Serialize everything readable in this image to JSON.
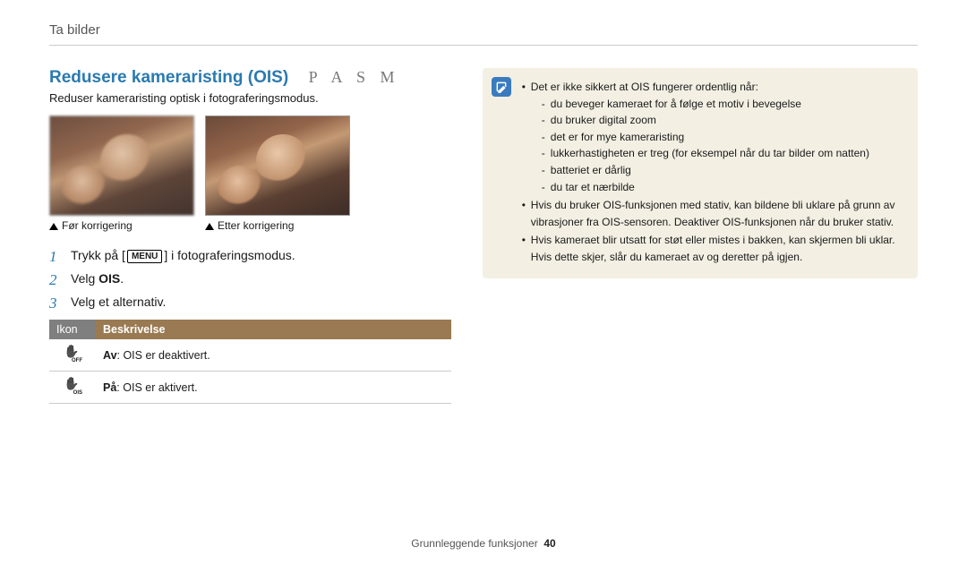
{
  "breadcrumb": "Ta bilder",
  "section": {
    "title": "Redusere kameraristing (OIS)",
    "modes": "P A S M",
    "subheading": "Reduser kameraristing optisk i fotograferingsmodus."
  },
  "captions": {
    "before": "Før korrigering",
    "after": "Etter korrigering"
  },
  "steps": {
    "s1_pre": "Trykk på [",
    "s1_menu": "MENU",
    "s1_post": "] i fotograferingsmodus.",
    "s2_pre": "Velg ",
    "s2_bold": "OIS",
    "s2_post": ".",
    "s3": "Velg et alternativ."
  },
  "table": {
    "head_ikon": "Ikon",
    "head_desc": "Beskrivelse",
    "rows": [
      {
        "sub": "OFF",
        "bold": "Av",
        "rest": ": OIS er deaktivert."
      },
      {
        "sub": "OIS",
        "bold": "På",
        "rest": ": OIS er aktivert."
      }
    ]
  },
  "note": {
    "items": [
      {
        "text": "Det er ikke sikkert at OIS fungerer ordentlig når:",
        "sub": [
          "du beveger kameraet for å følge et motiv i bevegelse",
          "du bruker digital zoom",
          "det er for mye kameraristing",
          "lukkerhastigheten er treg (for eksempel når du tar bilder om natten)",
          "batteriet er dårlig",
          "du tar et nærbilde"
        ]
      },
      {
        "text": "Hvis du bruker OIS-funksjonen med stativ, kan bildene bli uklare på grunn av vibrasjoner fra OIS-sensoren. Deaktiver OIS-funksjonen når du bruker stativ."
      },
      {
        "text": "Hvis kameraet blir utsatt for støt eller mistes i bakken, kan skjermen bli uklar. Hvis dette skjer, slår du kameraet av og deretter på igjen."
      }
    ]
  },
  "footer": {
    "section": "Grunnleggende funksjoner",
    "page": "40"
  }
}
